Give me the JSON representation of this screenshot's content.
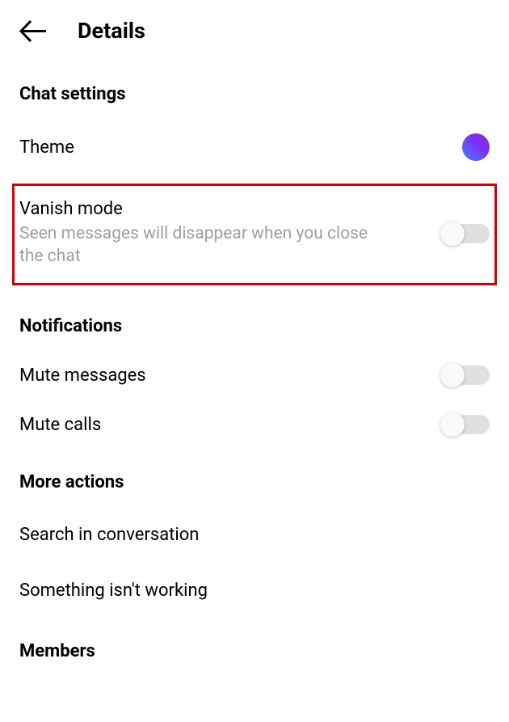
{
  "header": {
    "title": "Details"
  },
  "sections": {
    "chat_settings": {
      "header": "Chat settings",
      "theme_label": "Theme",
      "vanish": {
        "label": "Vanish mode",
        "subtitle": "Seen messages will disappear when you close the chat",
        "enabled": false
      }
    },
    "notifications": {
      "header": "Notifications",
      "mute_messages": {
        "label": "Mute messages",
        "enabled": false
      },
      "mute_calls": {
        "label": "Mute calls",
        "enabled": false
      }
    },
    "more_actions": {
      "header": "More actions",
      "search": "Search in conversation",
      "report": "Something isn't working"
    },
    "members": {
      "header": "Members"
    }
  },
  "colors": {
    "highlight_border": "#d40000",
    "theme_gradient_start": "#8a2be2",
    "theme_gradient_end": "#4a7fff"
  }
}
